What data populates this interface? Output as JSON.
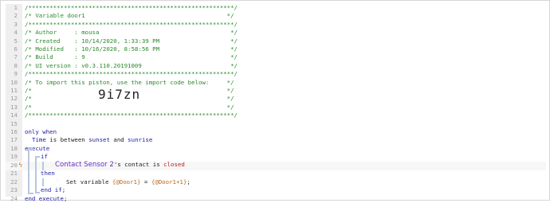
{
  "lines": [
    {
      "n": "1",
      "t": "/**********************************************************/"
    },
    {
      "n": "2",
      "t": "/* Variable door1                                        */"
    },
    {
      "n": "3",
      "t": "/**********************************************************/"
    },
    {
      "n": "4",
      "t": "/* Author     : mousa                                     */"
    },
    {
      "n": "5",
      "t": "/* Created    : 10/14/2020, 1:33:39 PM                    */"
    },
    {
      "n": "6",
      "t": "/* Modified   : 10/16/2020, 8:58:56 PM                    */"
    },
    {
      "n": "7",
      "t": "/* Build      : 9                                         */"
    },
    {
      "n": "8",
      "t": "/* UI version : v0.3.110.20191009                         */"
    },
    {
      "n": "9",
      "t": "/**********************************************************/"
    },
    {
      "n": "10",
      "t": "/* To import this piston, use the import code below:     */"
    },
    {
      "n": "11",
      "t": "/*                                                       */"
    },
    {
      "n": "12",
      "t": "/*                                                       */"
    },
    {
      "n": "13",
      "t": "/*                                                       */"
    },
    {
      "n": "14",
      "t": "/**********************************************************/"
    },
    {
      "n": "15",
      "t": ""
    },
    {
      "n": "16",
      "t": ""
    },
    {
      "n": "17",
      "t": ""
    },
    {
      "n": "18",
      "t": ""
    },
    {
      "n": "19",
      "t": ""
    },
    {
      "n": "20",
      "t": ""
    },
    {
      "n": "21",
      "t": ""
    },
    {
      "n": "22",
      "t": ""
    },
    {
      "n": "23",
      "t": ""
    },
    {
      "n": "24",
      "t": ""
    }
  ],
  "import_code": "9i7zn",
  "code": {
    "only_when": "only when",
    "time": "Time",
    "is_between": " is between ",
    "sunset": "sunset",
    "and": " and ",
    "sunrise": "sunrise",
    "execute": "execute",
    "if": "if",
    "device": "Contact Sensor 2",
    "device_suffix": "'s contact is ",
    "closed": "closed",
    "then": "then",
    "set_variable": "Set variable ",
    "var_expr": "{@Door1}",
    "equals": " = ",
    "value_expr": "{@Door1+1}",
    "semicolon": ";",
    "end_if": "end if;",
    "end_execute": "end execute;"
  },
  "colors": {
    "comment": "#2a8a2a",
    "keyword": "#1a1aa6",
    "device": "#6a2fc6",
    "value": "#b82020",
    "expression": "#b56a1a"
  },
  "icons": {
    "trigger_flag": "lightning-flag-icon"
  }
}
